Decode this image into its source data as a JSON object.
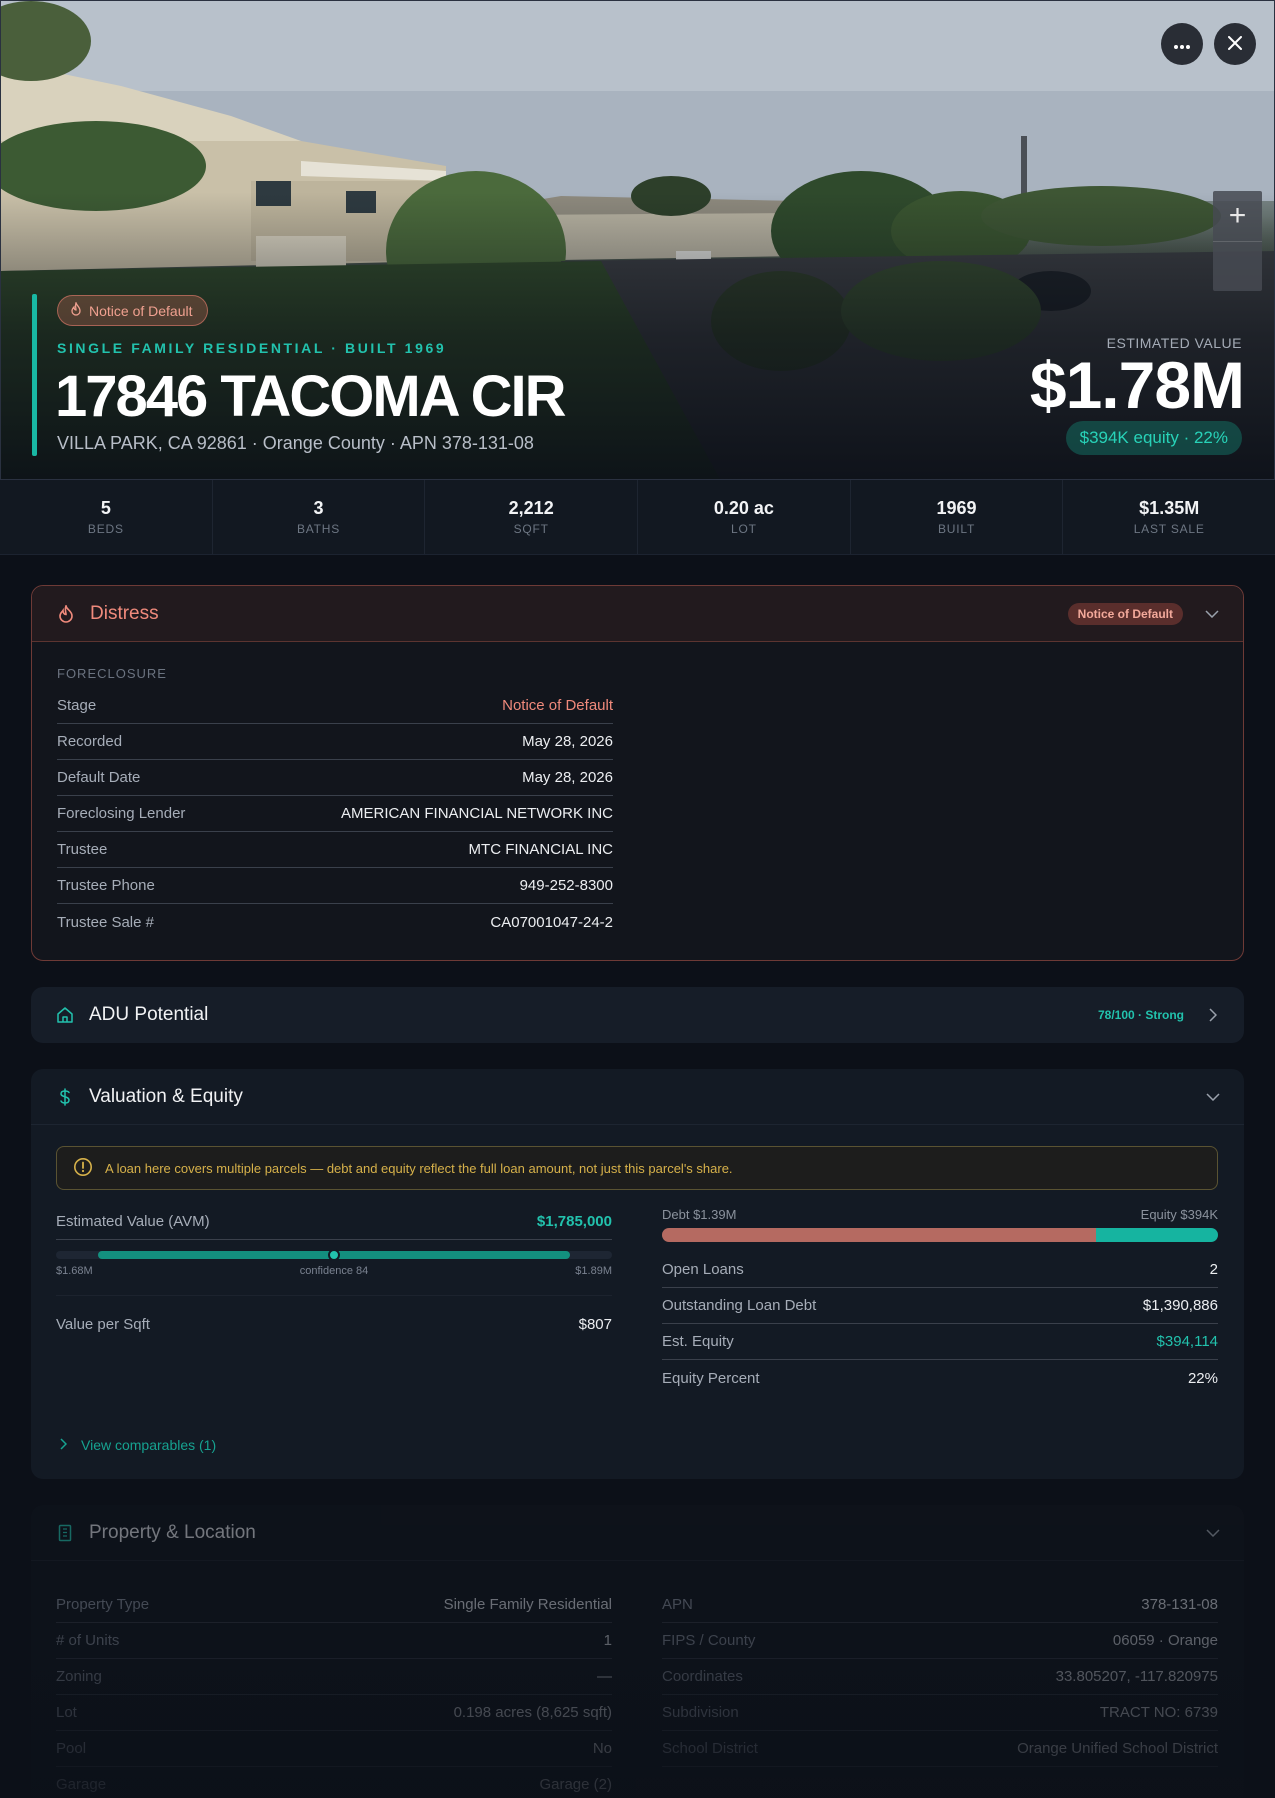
{
  "hero": {
    "distress_pill": "Notice of Default",
    "subtitle": "SINGLE FAMILY RESIDENTIAL · BUILT 1969",
    "title": "17846 TACOMA CIR",
    "address": "VILLA PARK, CA 92861 · Orange County · APN 378-131-08",
    "estimated_value_label": "ESTIMATED VALUE",
    "estimated_value": "$1.78M",
    "equity_pill": "$394K equity · 22%",
    "more_icon": "more-horizontal-icon",
    "close_icon": "close-icon",
    "zoom_in_label": "+",
    "zoom_out_label": "−"
  },
  "stats": [
    {
      "value": "5",
      "label": "BEDS"
    },
    {
      "value": "3",
      "label": "BATHS"
    },
    {
      "value": "2,212",
      "label": "SQFT"
    },
    {
      "value": "0.20 ac",
      "label": "LOT"
    },
    {
      "value": "1969",
      "label": "BUILT"
    },
    {
      "value": "$1.35M",
      "label": "LAST SALE"
    }
  ],
  "distress": {
    "title": "Distress",
    "badge": "Notice of Default",
    "section_label": "FORECLOSURE",
    "rows": [
      {
        "k": "Stage",
        "v": "Notice of Default"
      },
      {
        "k": "Recorded",
        "v": "May 28, 2026"
      },
      {
        "k": "Default Date",
        "v": "May 28, 2026"
      },
      {
        "k": "Foreclosing Lender",
        "v": "AMERICAN FINANCIAL NETWORK INC"
      },
      {
        "k": "Trustee",
        "v": "MTC FINANCIAL INC"
      },
      {
        "k": "Trustee Phone",
        "v": "949-252-8300"
      },
      {
        "k": "Trustee Sale #",
        "v": "CA07001047-24-2"
      }
    ]
  },
  "adu": {
    "title": "ADU Potential",
    "score": "78/100 · Strong",
    "score_value": 78
  },
  "valuation": {
    "title": "Valuation & Equity",
    "warning": "A loan here covers multiple parcels — debt and equity reflect the full loan amount, not just this parcel's share.",
    "avm_label": "Estimated Value (AVM)",
    "avm_value": "$1,785,000",
    "range_low": "$1.68M",
    "range_high": "$1.89M",
    "confidence_label": "confidence 84",
    "range_low_num": 1.68,
    "range_high_num": 1.89,
    "estimate_num": 1.785,
    "value_per_sqft_label": "Value per Sqft",
    "value_per_sqft": "$807",
    "debt_label": "Debt $1.39M",
    "equity_label": "Equity $394K",
    "debt_fraction": 0.78,
    "rows": [
      {
        "k": "Open Loans",
        "v": "2"
      },
      {
        "k": "Outstanding Loan Debt",
        "v": "$1,390,886"
      },
      {
        "k": "Est. Equity",
        "v": "$394,114"
      },
      {
        "k": "Equity Percent",
        "v": "22%"
      }
    ],
    "view_comparables": "View comparables (1)"
  },
  "property": {
    "title": "Property & Location",
    "left": [
      {
        "k": "Property Type",
        "v": "Single Family Residential"
      },
      {
        "k": "# of Units",
        "v": "1"
      },
      {
        "k": "Zoning",
        "v": "—"
      },
      {
        "k": "Lot",
        "v": "0.198 acres (8,625 sqft)"
      },
      {
        "k": "Pool",
        "v": "No"
      },
      {
        "k": "Garage",
        "v": "Garage (2)"
      }
    ],
    "right": [
      {
        "k": "APN",
        "v": "378-131-08"
      },
      {
        "k": "FIPS / County",
        "v": "06059 · Orange"
      },
      {
        "k": "Coordinates",
        "v": "33.805207, -117.820975"
      },
      {
        "k": "Subdivision",
        "v": "TRACT NO: 6739"
      },
      {
        "k": "School District",
        "v": "Orange Unified School District"
      }
    ]
  },
  "colors": {
    "accent": "#22c2ad",
    "distress": "#f08a7c",
    "warning": "#d6b14a",
    "debt": "#b56a61"
  }
}
